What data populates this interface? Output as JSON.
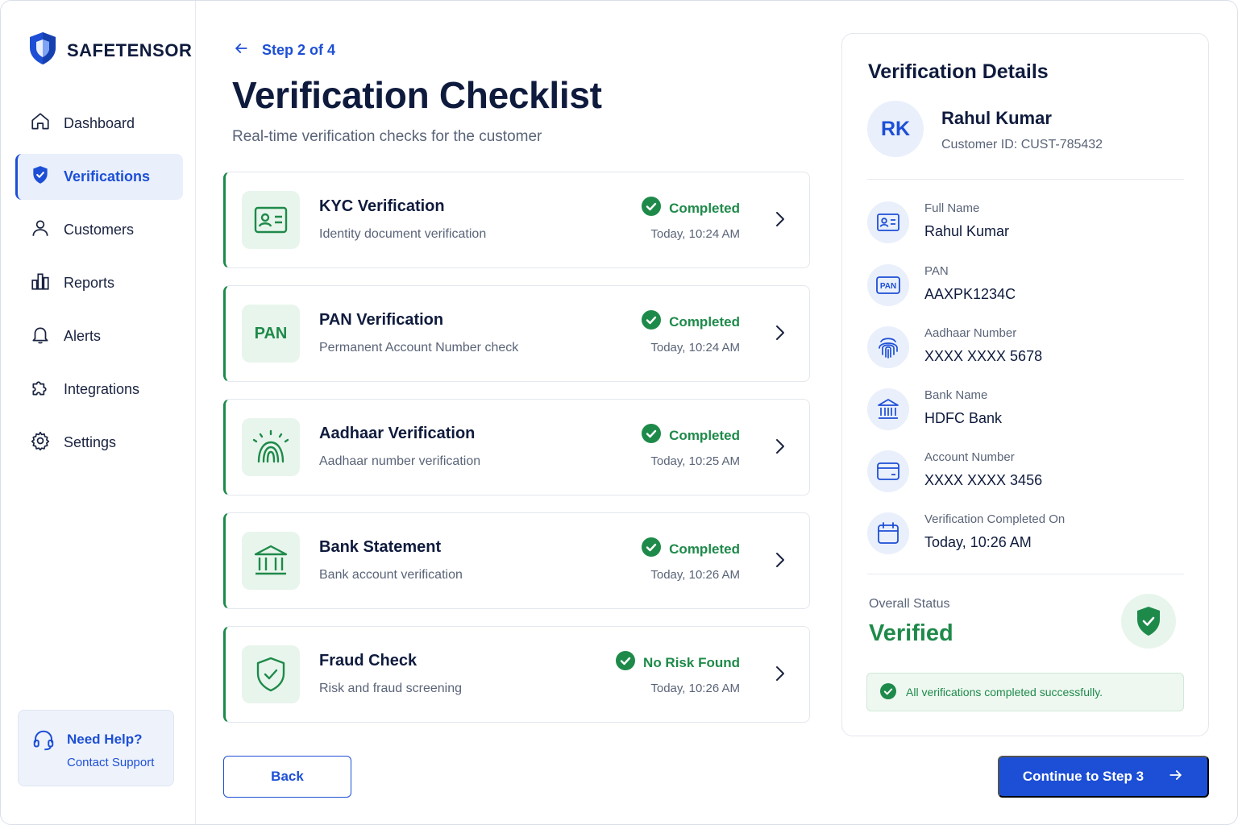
{
  "brand": {
    "name": "SAFETENSOR"
  },
  "sidebar": {
    "items": [
      {
        "label": "Dashboard",
        "icon": "home-icon"
      },
      {
        "label": "Verifications",
        "icon": "shield-check-icon",
        "active": true
      },
      {
        "label": "Customers",
        "icon": "user-icon"
      },
      {
        "label": "Reports",
        "icon": "bar-chart-icon"
      },
      {
        "label": "Alerts",
        "icon": "bell-icon"
      },
      {
        "label": "Integrations",
        "icon": "puzzle-icon"
      },
      {
        "label": "Settings",
        "icon": "gear-icon"
      }
    ],
    "help": {
      "title": "Need Help?",
      "link": "Contact Support"
    }
  },
  "header": {
    "step": "Step 2 of 4",
    "title": "Verification Checklist",
    "subtitle": "Real-time verification checks for the customer"
  },
  "checks": [
    {
      "title": "KYC Verification",
      "subtitle": "Identity document verification",
      "status": "Completed",
      "time": "Today, 10:24 AM",
      "icon": "id-card-icon"
    },
    {
      "title": "PAN Verification",
      "subtitle": "Permanent Account Number check",
      "status": "Completed",
      "time": "Today, 10:24 AM",
      "icon": "pan-text-icon",
      "icon_text": "PAN"
    },
    {
      "title": "Aadhaar Verification",
      "subtitle": "Aadhaar number verification",
      "status": "Completed",
      "time": "Today, 10:25 AM",
      "icon": "aadhaar-fingerprint-icon"
    },
    {
      "title": "Bank Statement",
      "subtitle": "Bank account verification",
      "status": "Completed",
      "time": "Today, 10:26 AM",
      "icon": "bank-icon"
    },
    {
      "title": "Fraud Check",
      "subtitle": "Risk and fraud screening",
      "status": "No Risk Found",
      "time": "Today, 10:26 AM",
      "icon": "shield-check-icon"
    }
  ],
  "buttons": {
    "back": "Back",
    "continue": "Continue to Step 3"
  },
  "details": {
    "title": "Verification Details",
    "avatar_initials": "RK",
    "customer_name": "Rahul Kumar",
    "customer_id": "Customer ID: CUST-785432",
    "fields": [
      {
        "label": "Full Name",
        "value": "Rahul Kumar",
        "icon": "id-card-icon"
      },
      {
        "label": "PAN",
        "value": "AAXPK1234C",
        "icon": "pan-card-icon",
        "icon_text": "PAN"
      },
      {
        "label": "Aadhaar Number",
        "value": "XXXX XXXX 5678",
        "icon": "fingerprint-icon"
      },
      {
        "label": "Bank Name",
        "value": "HDFC Bank",
        "icon": "bank-icon"
      },
      {
        "label": "Account Number",
        "value": "XXXX XXXX 3456",
        "icon": "card-icon"
      },
      {
        "label": "Verification Completed On",
        "value": "Today, 10:26 AM",
        "icon": "calendar-icon"
      }
    ],
    "overall_label": "Overall Status",
    "overall_value": "Verified",
    "success_message": "All verifications completed successfully."
  },
  "colors": {
    "primary": "#1d4fd6",
    "success": "#1e8a4a",
    "text": "#0f1b3d",
    "muted": "#5a6478"
  }
}
